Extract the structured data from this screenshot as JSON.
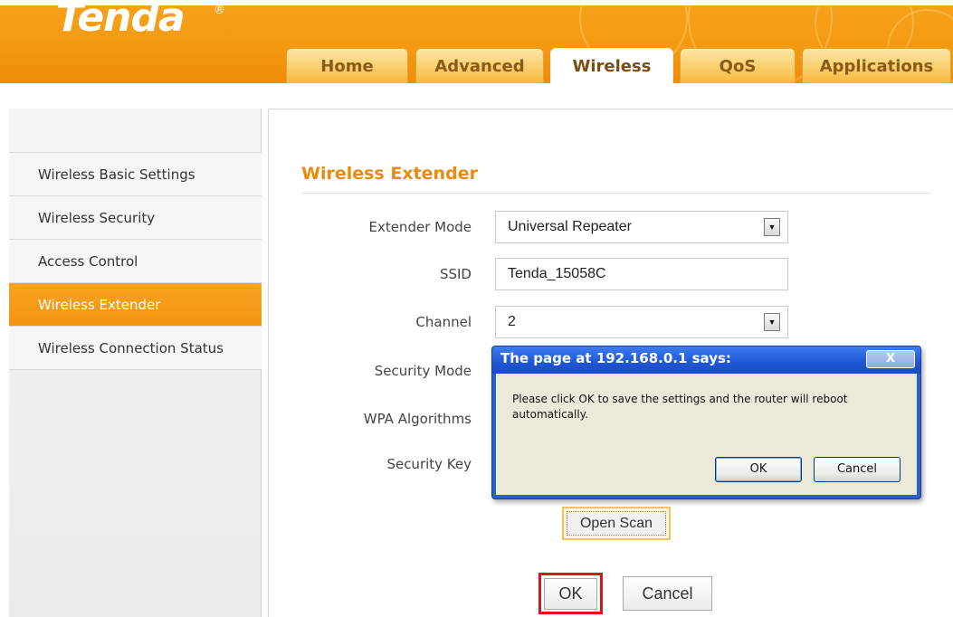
{
  "brand": {
    "logo_text": "Tenda",
    "registered_mark": "®"
  },
  "nav": {
    "tabs": [
      {
        "label": "Home",
        "active": false
      },
      {
        "label": "Advanced",
        "active": false
      },
      {
        "label": "Wireless",
        "active": true
      },
      {
        "label": "QoS",
        "active": false
      },
      {
        "label": "Applications",
        "active": false
      }
    ]
  },
  "sidebar": {
    "items": [
      {
        "label": "Wireless Basic Settings",
        "active": false
      },
      {
        "label": "Wireless Security",
        "active": false
      },
      {
        "label": "Access Control",
        "active": false
      },
      {
        "label": "Wireless Extender",
        "active": true
      },
      {
        "label": "Wireless Connection Status",
        "active": false
      }
    ]
  },
  "main": {
    "section_title": "Wireless Extender",
    "extender_mode": {
      "label": "Extender Mode",
      "value": "Universal Repeater"
    },
    "ssid": {
      "label": "SSID",
      "value": "Tenda_15058C"
    },
    "channel": {
      "label": "Channel",
      "value": "2"
    },
    "security_mode": {
      "label": "Security Mode"
    },
    "wpa_algorithms": {
      "label": "WPA Algorithms"
    },
    "security_key": {
      "label": "Security Key"
    },
    "open_scan_label": "Open Scan",
    "ok_label": "OK",
    "cancel_label": "Cancel"
  },
  "dialog": {
    "title": "The page at 192.168.0.1 says:",
    "close_symbol": "X",
    "message": "Please click OK to save the settings and the router will reboot automatically.",
    "ok_label": "OK",
    "cancel_label": "Cancel"
  },
  "colors": {
    "brand_orange": "#f39a12",
    "title_orange": "#e98b0c",
    "highlight_red": "#d9151a",
    "dialog_blue": "#1f56d4"
  },
  "icons": {
    "dropdown": "chevron-down-icon",
    "close": "close-icon"
  }
}
